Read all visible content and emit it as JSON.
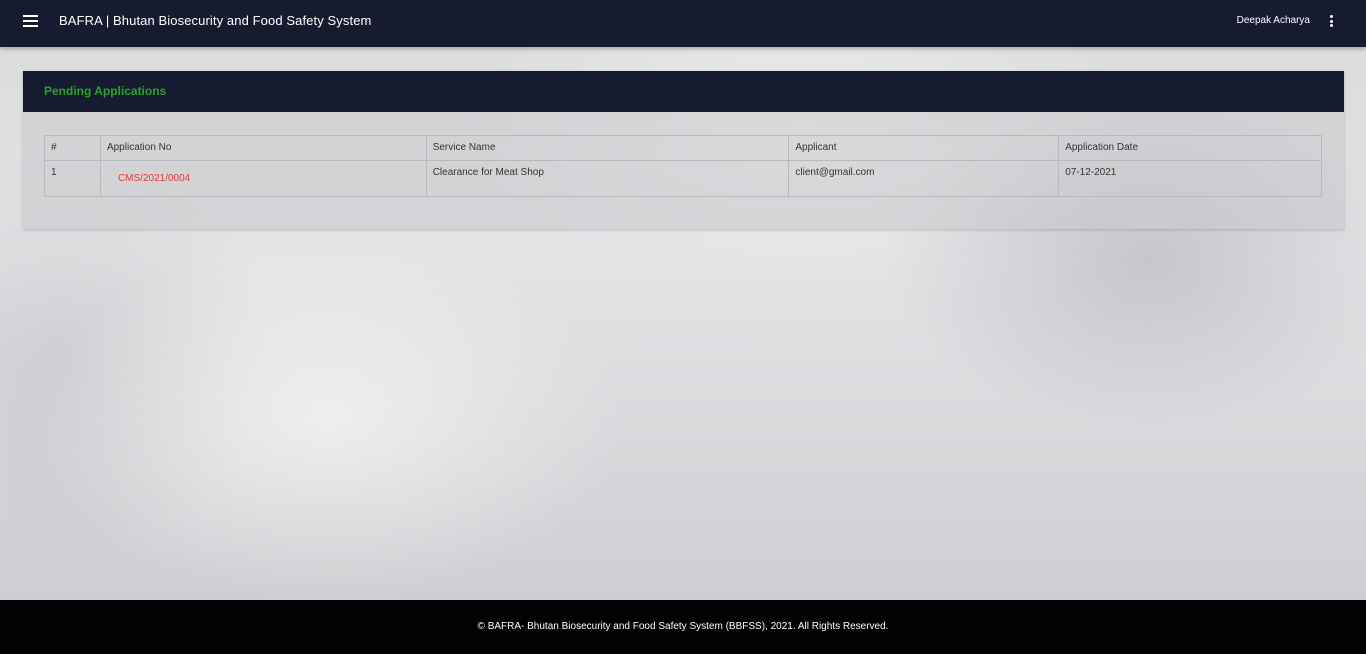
{
  "header": {
    "title": "BAFRA | Bhutan Biosecurity and Food Safety System",
    "user_name": "Deepak Acharya",
    "menu_icon": "hamburger-menu-icon",
    "more_icon": "vertical-dots-icon"
  },
  "card": {
    "title": "Pending Applications"
  },
  "table": {
    "columns": [
      "#",
      "Application No",
      "Service Name",
      "Applicant",
      "Application Date"
    ],
    "rows": [
      {
        "index": "1",
        "application_no": "CMS/2021/0004",
        "service_name": "Clearance for Meat Shop",
        "applicant": "client@gmail.com",
        "application_date": "07-12-2021"
      }
    ]
  },
  "footer": {
    "text": "© BAFRA- Bhutan Biosecurity and Food Safety System (BBFSS), 2021. All Rights Reserved."
  },
  "colors": {
    "navbar": "#171b2f",
    "card_title": "#27a327",
    "link": "#e53935",
    "footer": "#020204"
  }
}
